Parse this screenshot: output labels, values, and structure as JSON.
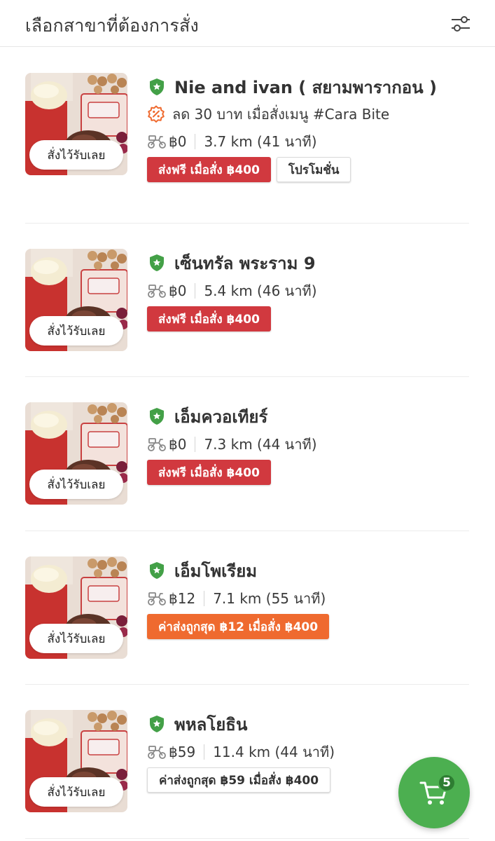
{
  "header": {
    "title": "เลือกสาขาที่ต้องการสั่ง",
    "filter_icon": "sliders-icon"
  },
  "branches": [
    {
      "name": "Nie and ivan ( สยามพารากอน )",
      "promo": "ลด 30 บาท เมื่อสั่งเมนู #Cara Bite",
      "fee": "฿0",
      "distance": "3.7 km (41 นาที)",
      "preorder_label": "สั่งไว้รับเลย",
      "tags": [
        {
          "label": "ส่งฟรี เมื่อสั่ง ฿400",
          "style": "red"
        },
        {
          "label": "โปรโมชั่น",
          "style": "outline"
        }
      ]
    },
    {
      "name": "เซ็นทรัล พระราม 9",
      "promo": "",
      "fee": "฿0",
      "distance": "5.4 km (46 นาที)",
      "preorder_label": "สั่งไว้รับเลย",
      "tags": [
        {
          "label": "ส่งฟรี เมื่อสั่ง ฿400",
          "style": "red"
        }
      ]
    },
    {
      "name": "เอ็มควอเทียร์",
      "promo": "",
      "fee": "฿0",
      "distance": "7.3 km (44 นาที)",
      "preorder_label": "สั่งไว้รับเลย",
      "tags": [
        {
          "label": "ส่งฟรี เมื่อสั่ง ฿400",
          "style": "red"
        }
      ]
    },
    {
      "name": "เอ็มโพเรียม",
      "promo": "",
      "fee": "฿12",
      "distance": "7.1 km (55 นาที)",
      "preorder_label": "สั่งไว้รับเลย",
      "tags": [
        {
          "label": "ค่าส่งถูกสุด ฿12 เมื่อสั่ง ฿400",
          "style": "orange"
        }
      ]
    },
    {
      "name": "พหลโยธิน",
      "promo": "",
      "fee": "฿59",
      "distance": "11.4 km (44 นาที)",
      "preorder_label": "สั่งไว้รับเลย",
      "tags": [
        {
          "label": "ค่าส่งถูกสุด ฿59 เมื่อสั่ง ฿400",
          "style": "outline"
        }
      ]
    }
  ],
  "cart": {
    "count": "5",
    "icon": "cart-icon"
  },
  "colors": {
    "verified": "#43a047",
    "tag_red": "#d1393f",
    "tag_orange": "#ef6a2f",
    "fab": "#4caf50",
    "promo_icon": "#ef6a2f"
  }
}
